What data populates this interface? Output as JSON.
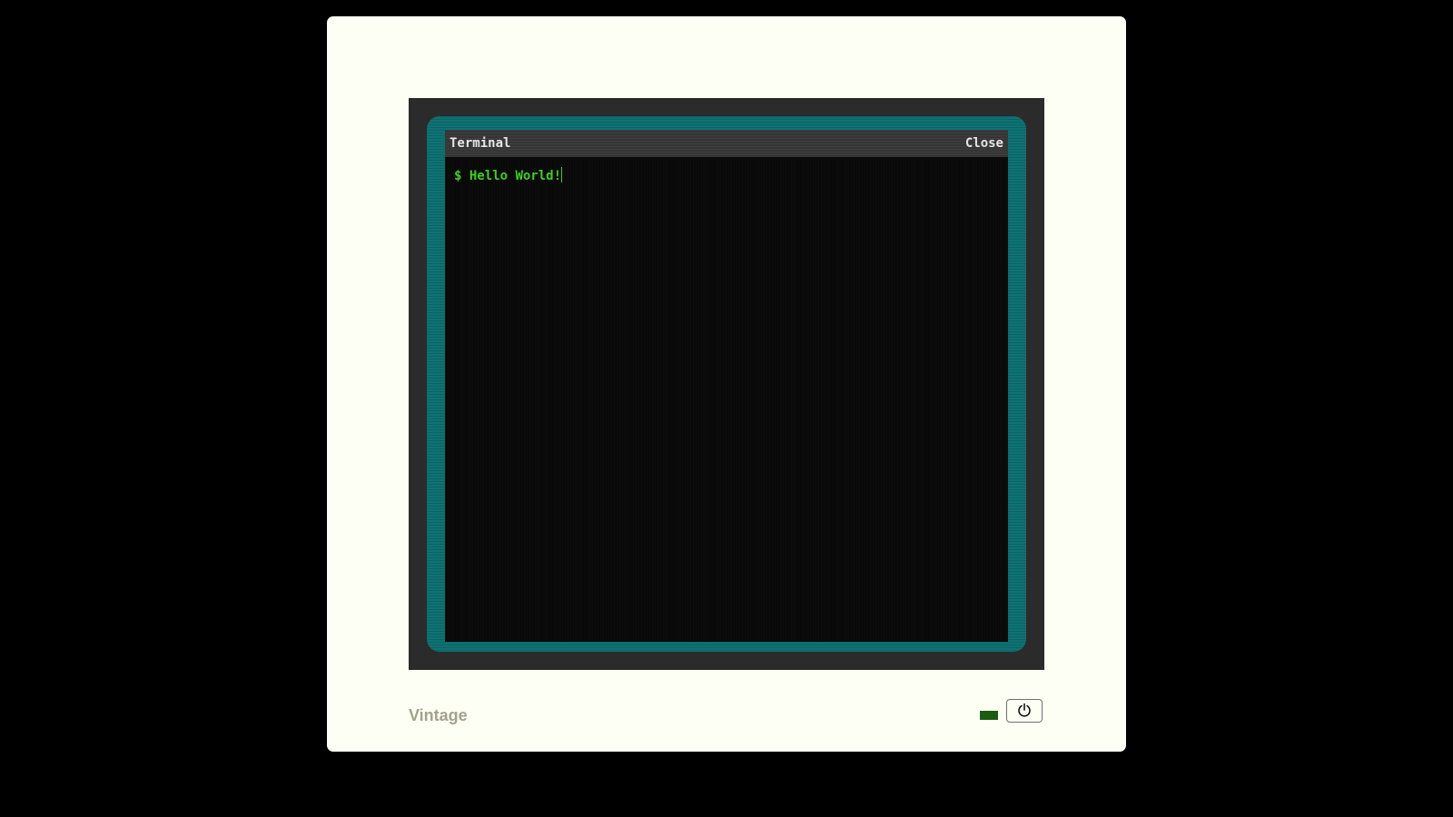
{
  "terminal": {
    "title": "Terminal",
    "close_label": "Close",
    "prompt": "$",
    "command": "Hello World!"
  },
  "monitor": {
    "brand": "Vintage",
    "power_icon": "power-icon",
    "led_color": "#1a5c11",
    "frame_color": "#0e7273",
    "text_color": "#3bd11f"
  }
}
